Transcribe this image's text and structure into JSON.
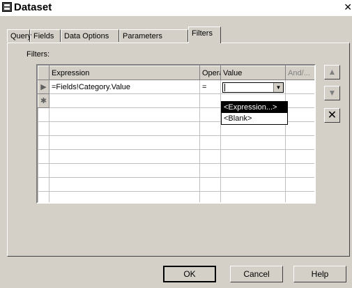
{
  "window": {
    "title": "Dataset",
    "close_glyph": "✕"
  },
  "tabs": [
    {
      "label": "Query"
    },
    {
      "label": "Fields"
    },
    {
      "label": "Data Options"
    },
    {
      "label": "Parameters"
    },
    {
      "label": "Filters",
      "active": true
    }
  ],
  "filters": {
    "label": "Filters:",
    "columns": [
      "Expression",
      "Operat...",
      "Value",
      "And/..."
    ],
    "rows": [
      {
        "marker": "▶",
        "expression": "=Fields!Category.Value",
        "operator": "=",
        "value": ""
      },
      {
        "marker": "✱",
        "expression": "",
        "operator": "",
        "value": ""
      }
    ],
    "dropdown_options": [
      "<Expression...>",
      "<Blank>"
    ],
    "dropdown_selected": "<Expression...>"
  },
  "side_buttons": {
    "up_icon": "arrow-up-icon",
    "down_icon": "arrow-down-icon",
    "delete_icon": "delete-x-icon"
  },
  "buttons": {
    "ok": "OK",
    "cancel": "Cancel",
    "help": "Help"
  }
}
